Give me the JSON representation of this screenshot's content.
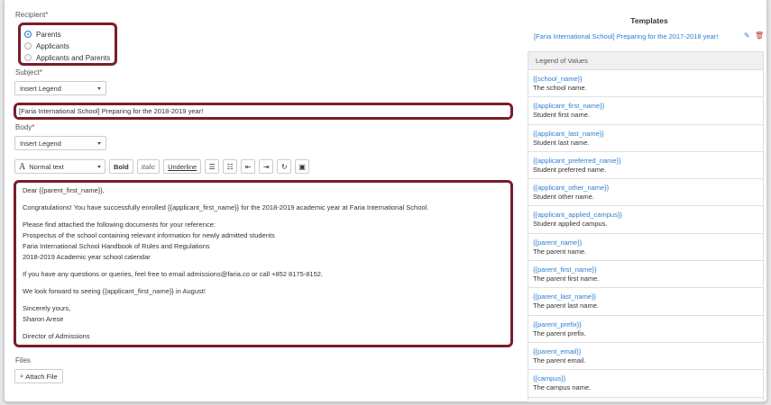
{
  "recipient": {
    "label": "Recipient",
    "required_mark": "*",
    "options": [
      {
        "label": "Parents",
        "selected": true
      },
      {
        "label": "Applicants",
        "selected": false
      },
      {
        "label": "Applicants and Parents",
        "selected": false
      }
    ]
  },
  "subject": {
    "label": "Subject",
    "required_mark": "*",
    "insert_legend": "Insert Legend",
    "value": "[Faria International School] Preparing for the 2018-2019 year!"
  },
  "body": {
    "label": "Body",
    "required_mark": "*",
    "insert_legend": "Insert Legend",
    "toolbar": {
      "format_select": "Normal text",
      "bold": "Bold",
      "italic": "Italic",
      "underline": "Underline"
    },
    "lines": [
      "Dear {{parent_first_name}},",
      "Congratulations! You have successfully enrolled {{applicant_first_name}} for the 2018-2019 academic year at Faria International School.",
      "Please find attached the following documents for your reference:",
      "Prospectus of the school containing relevant information for newly admitted students",
      "Faria International School Handbook of Rules and Regulations",
      "2018-2019 Academic year school calendar",
      "If you have any questions or queries, feel free to email admissions@faria.co or call +852 8175-8152.",
      "We look forward to seeing {{applicant_first_name}} in August!",
      "Sincerely yours,",
      "Sharon Arese",
      "Director of Admissions"
    ]
  },
  "files": {
    "label": "Files",
    "attach_button": "Attach File"
  },
  "templates": {
    "title": "Templates",
    "link": "[Faria International School] Preparing for the 2017-2018 year!"
  },
  "legend": {
    "title": "Legend of Values",
    "items": [
      {
        "key": "{{school_name}}",
        "desc": "The school name."
      },
      {
        "key": "{{applicant_first_name}}",
        "desc": "Student first name."
      },
      {
        "key": "{{applicant_last_name}}",
        "desc": "Student last name."
      },
      {
        "key": "{{applicant_preferred_name}}",
        "desc": "Student preferred name."
      },
      {
        "key": "{{applicant_other_name}}",
        "desc": "Student other name."
      },
      {
        "key": "{{applicant_applied_campus}}",
        "desc": "Student applied campus."
      },
      {
        "key": "{{parent_name}}",
        "desc": "The parent name."
      },
      {
        "key": "{{parent_first_name}}",
        "desc": "The parent first name."
      },
      {
        "key": "{{parent_last_name}}",
        "desc": "The parent last name."
      },
      {
        "key": "{{parent_prefix}}",
        "desc": "The parent prefix."
      },
      {
        "key": "{{parent_email}}",
        "desc": "The parent email."
      },
      {
        "key": "{{campus}}",
        "desc": "The campus name."
      }
    ]
  },
  "colors": {
    "accent": "#2d7dd2",
    "callout": "#7a1d2a",
    "required": "#c0392b"
  }
}
